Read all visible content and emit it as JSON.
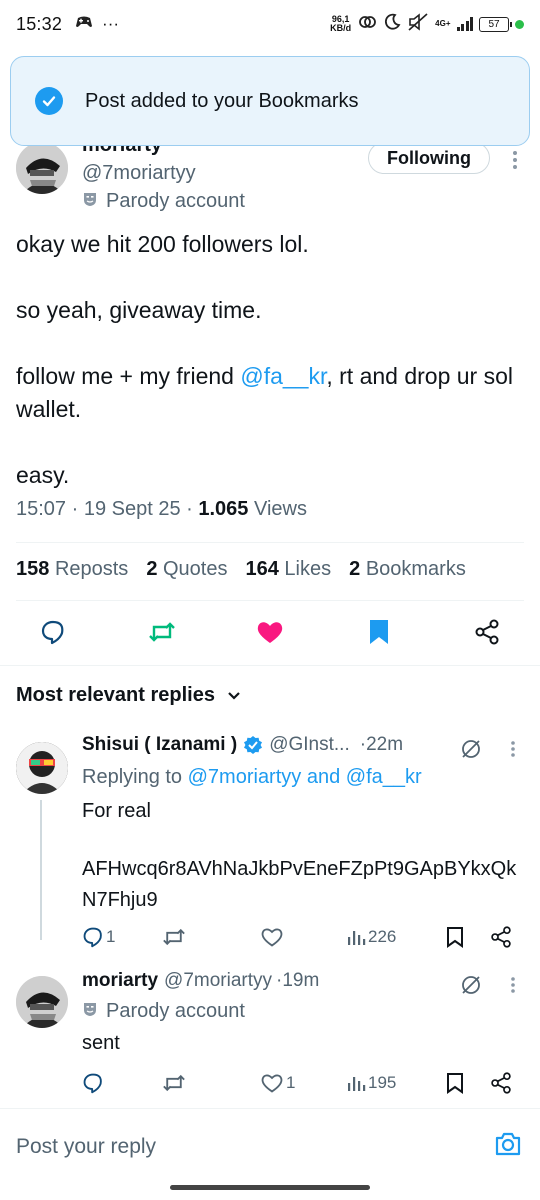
{
  "status_bar": {
    "time": "15:32",
    "more": "···",
    "net_speed_value": "96,1",
    "net_speed_unit": "KB/d",
    "network_type": "4G+",
    "battery": "57"
  },
  "toast": {
    "message": "Post added to your Bookmarks"
  },
  "post": {
    "author_name": "moriarty",
    "author_handle": "@7moriartyy",
    "parody_label": "Parody account",
    "follow_label": "Following",
    "text": {
      "p1": "okay we hit 200 followers lol.",
      "p2": "so yeah, giveaway time.",
      "p3_before": "follow me + my friend ",
      "p3_mention": "@fa__kr",
      "p3_after": ", rt and drop ur sol wallet.",
      "p4": "easy."
    },
    "time": "15:07",
    "date": "19 Sept 25",
    "views_count": "1.065",
    "views_label": "Views",
    "stats": {
      "reposts_count": "158",
      "reposts_label": "Reposts",
      "quotes_count": "2",
      "quotes_label": "Quotes",
      "likes_count": "164",
      "likes_label": "Likes",
      "bookmarks_count": "2",
      "bookmarks_label": "Bookmarks"
    }
  },
  "replies_header": {
    "label": "Most relevant replies"
  },
  "replies": [
    {
      "name": "Shisui ( Izanami )",
      "handle": "@GInst...",
      "time": "22m",
      "replying_prefix": "Replying to ",
      "replying_1": "@7moriartyy",
      "replying_and": " and ",
      "replying_2": "@fa__kr",
      "text_1": "For real",
      "text_2": "AFHwcq6r8AVhNaJkbPvEneFZpPt9GApBYkxQkN7Fhju9",
      "reply_count": "1",
      "views": "226"
    },
    {
      "name": "moriarty",
      "handle": "@7moriartyy",
      "time": "19m",
      "parody_label": "Parody account",
      "text_1": "sent",
      "like_count": "1",
      "views": "195"
    }
  ],
  "composer": {
    "placeholder": "Post your reply"
  },
  "colors": {
    "accent": "#1d9bf0",
    "like": "#f91880",
    "repost": "#00ba7c",
    "text": "#0f1419",
    "muted": "#536471"
  }
}
